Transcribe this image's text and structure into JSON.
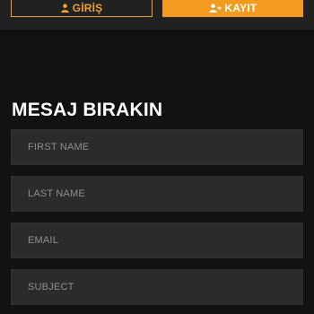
{
  "header": {
    "login_label": "GİRİŞ",
    "register_label": "KAYIT",
    "login_icon": "user-icon",
    "register_icon": "user-plus-icon"
  },
  "contact": {
    "title": "MESAJ BIRAKIN",
    "fields": [
      {
        "placeholder": "FIRST NAME"
      },
      {
        "placeholder": "LAST NAME"
      },
      {
        "placeholder": "EMAIL"
      },
      {
        "placeholder": "SUBJECT"
      }
    ]
  },
  "colors": {
    "accent": "#f49a1e",
    "background": "#121212",
    "field_bg": "#2b2b2b",
    "top_bar": "#212121"
  }
}
